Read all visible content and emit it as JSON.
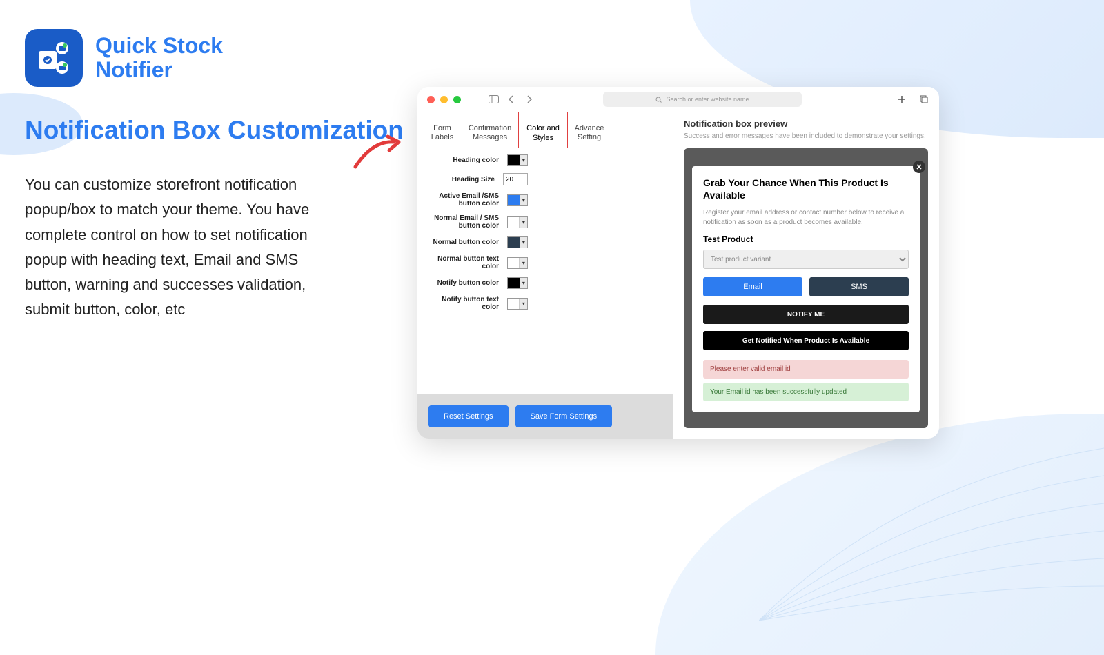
{
  "app": {
    "title_line1": "Quick Stock",
    "title_line2": "Notifier"
  },
  "page": {
    "title": "Notification Box Customization",
    "description": "You can customize storefront notification popup/box to match your theme. You have complete control on how to set notification popup with heading text, Email and SMS button, warning and successes validation, submit button, color, etc"
  },
  "browser": {
    "search_placeholder": "Search or enter website name"
  },
  "tabs": [
    {
      "label": "Form\nLabels"
    },
    {
      "label": "Confirmation\nMessages"
    },
    {
      "label": "Color and\nStyles",
      "active": true
    },
    {
      "label": "Advance\nSetting"
    }
  ],
  "settings": [
    {
      "label": "Heading color",
      "type": "color",
      "value": "#000000"
    },
    {
      "label": "Heading Size",
      "type": "text",
      "value": "20"
    },
    {
      "label": "Active Email /SMS button color",
      "type": "color",
      "value": "#2d7cf0"
    },
    {
      "label": "Normal Email / SMS button color",
      "type": "color",
      "value": "#ffffff"
    },
    {
      "label": "Normal button color",
      "type": "color",
      "value": "#2c3e50"
    },
    {
      "label": "Normal button text color",
      "type": "color",
      "value": "#ffffff"
    },
    {
      "label": "Notify button color",
      "type": "color",
      "value": "#000000"
    },
    {
      "label": "Notify button text color",
      "type": "color",
      "value": "#ffffff"
    }
  ],
  "actions": {
    "reset": "Reset Settings",
    "save": "Save Form Settings"
  },
  "preview": {
    "title": "Notification box preview",
    "subtitle": "Success and error messages have been included to demonstrate your settings.",
    "popup": {
      "heading": "Grab Your Chance When This Product Is Available",
      "sub": "Register your email address or contact number below to receive a notification as soon as a product becomes available.",
      "product": "Test Product",
      "variant": "Test product variant",
      "email_btn": "Email",
      "sms_btn": "SMS",
      "notify_btn": "NOTIFY ME",
      "get_notified_btn": "Get Notified When Product Is Available",
      "error_msg": "Please enter valid email id",
      "success_msg": "Your Email id has been successfully updated"
    }
  }
}
